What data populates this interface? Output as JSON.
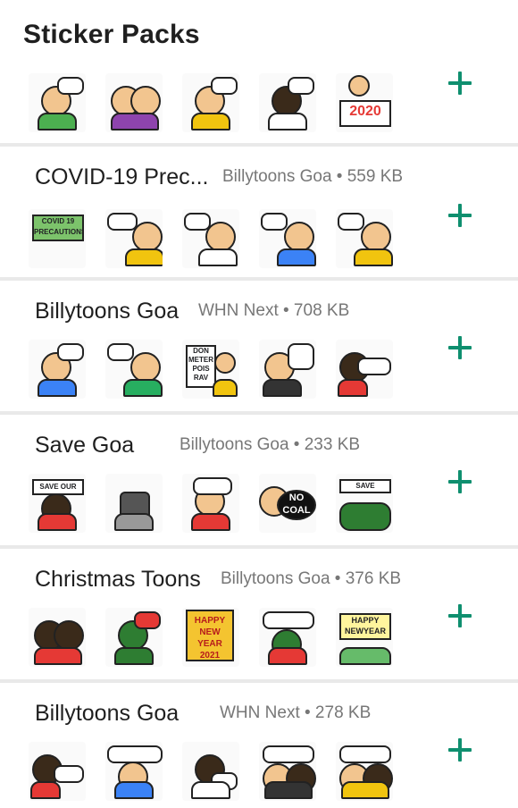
{
  "header": {
    "title": "Sticker Packs"
  },
  "packs": [
    {
      "name": "",
      "meta": ""
    },
    {
      "name": "COVID-19 Prec...",
      "meta": "Billytoons Goa • 559 KB"
    },
    {
      "name": "Billytoons Goa",
      "meta": "WHN Next • 708 KB"
    },
    {
      "name": "Save Goa",
      "meta": "Billytoons Goa • 233 KB"
    },
    {
      "name": "Christmas Toons",
      "meta": "Billytoons Goa • 376 KB"
    },
    {
      "name": "Billytoons Goa",
      "meta": "WHN Next • 278 KB"
    }
  ],
  "sticker_texts": {
    "p0_s4": "2020",
    "p1_s0": "COVID 19 PRECAUTIONS",
    "p2_s2": "DON METER POIS RAV",
    "p3_s0": "SAVE OUR LAND",
    "p3_s3": "NO COAL",
    "p3_s4": "SAVE MOLLEM",
    "p4_s2": "HAPPY NEW YEAR 2021",
    "p4_s4": "HAPPY NEWYEAR 2021"
  },
  "colors": {
    "accent": "#0f8f6f",
    "divider": "#e9e9e9"
  }
}
